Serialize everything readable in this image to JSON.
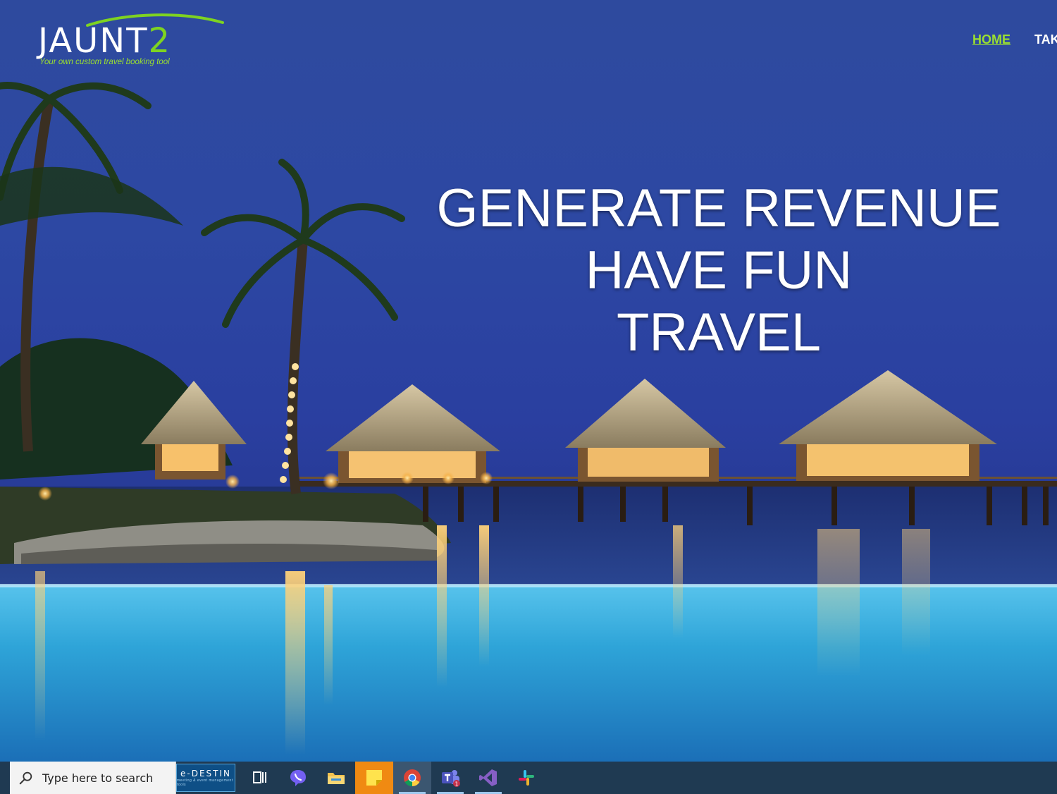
{
  "brand": {
    "name_main": "JAUNT",
    "name_accent": "2",
    "tagline": "Your own custom travel booking tool"
  },
  "nav": {
    "items": [
      {
        "label": "HOME",
        "active": true
      },
      {
        "label": "TAKE",
        "active": false
      }
    ]
  },
  "hero": {
    "lines": [
      "GENERATE REVENUE",
      "HAVE FUN",
      "TRAVEL"
    ]
  },
  "taskbar": {
    "search_placeholder": "Type here to search",
    "pinned_tile": {
      "name": "e-DESTIN",
      "sub": "meeting & event management tools"
    },
    "apps": [
      {
        "icon": "task-view-icon"
      },
      {
        "icon": "viber-icon"
      },
      {
        "icon": "file-explorer-icon"
      },
      {
        "icon": "sticky-notes-icon"
      },
      {
        "icon": "chrome-icon"
      },
      {
        "icon": "teams-icon",
        "badge": "1"
      },
      {
        "icon": "visual-studio-icon"
      },
      {
        "icon": "slack-icon"
      }
    ]
  },
  "colors": {
    "accent_green": "#9be02f",
    "sky": "#2d48a3",
    "pool": "#2fa6d8",
    "taskbar": "#1f3a52"
  }
}
